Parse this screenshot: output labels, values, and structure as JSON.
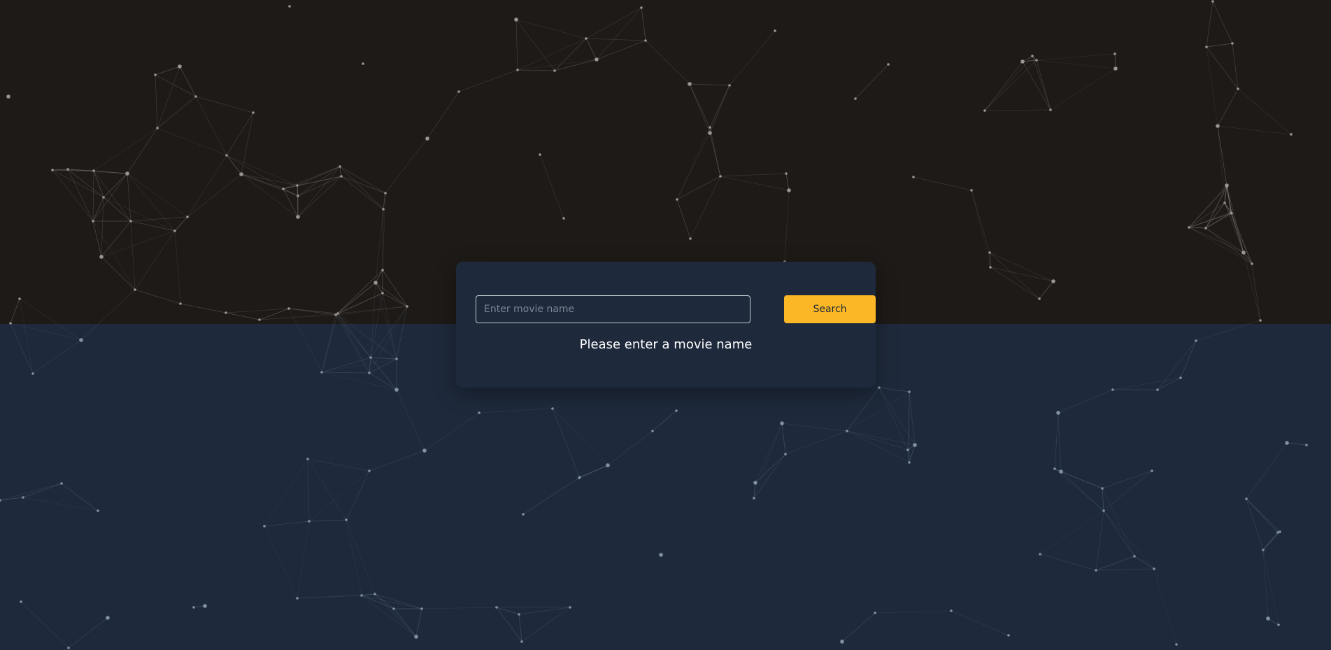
{
  "colors": {
    "background_top": "#1e1a17",
    "background_bottom": "#1e293b",
    "card": "#1e293b",
    "accent": "#fbb725",
    "button_text": "#1e293b",
    "network_top": "#8a857e",
    "network_bottom": "#64748b"
  },
  "search": {
    "placeholder": "Enter movie name",
    "value": "",
    "button_label": "Search"
  },
  "status": {
    "message": "Please enter a movie name"
  }
}
